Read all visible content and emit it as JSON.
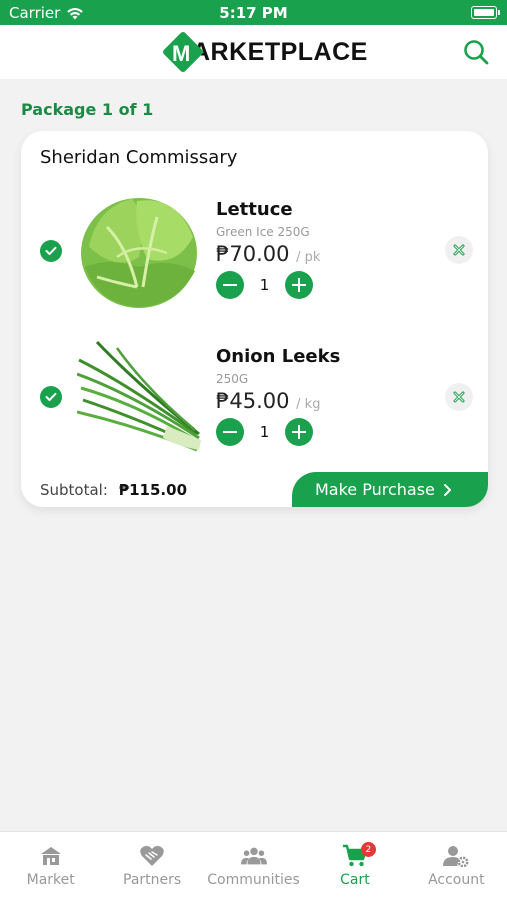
{
  "status_bar": {
    "carrier": "Carrier",
    "time": "5:17 PM"
  },
  "header": {
    "logo_letter": "M",
    "logo_text": "ARKETPLACE"
  },
  "package_label": "Package 1 of 1",
  "store": {
    "name": "Sheridan Commissary",
    "items": [
      {
        "name": "Lettuce",
        "variant": "Green Ice 250G",
        "price": "₱70.00",
        "unit": "/ pk",
        "qty": "1"
      },
      {
        "name": "Onion Leeks",
        "variant": "250G",
        "price": "₱45.00",
        "unit": "/ kg",
        "qty": "1"
      }
    ],
    "subtotal_label": "Subtotal:",
    "subtotal_value": "₱115.00",
    "purchase_label": "Make Purchase"
  },
  "tabs": [
    {
      "label": "Market",
      "icon": "market-icon"
    },
    {
      "label": "Partners",
      "icon": "handshake-heart-icon"
    },
    {
      "label": "Communities",
      "icon": "people-group-icon"
    },
    {
      "label": "Cart",
      "icon": "cart-icon",
      "badge": "2",
      "active": true
    },
    {
      "label": "Account",
      "icon": "user-gear-icon"
    }
  ],
  "colors": {
    "brand": "#1aa14d",
    "badge": "#e53935"
  }
}
